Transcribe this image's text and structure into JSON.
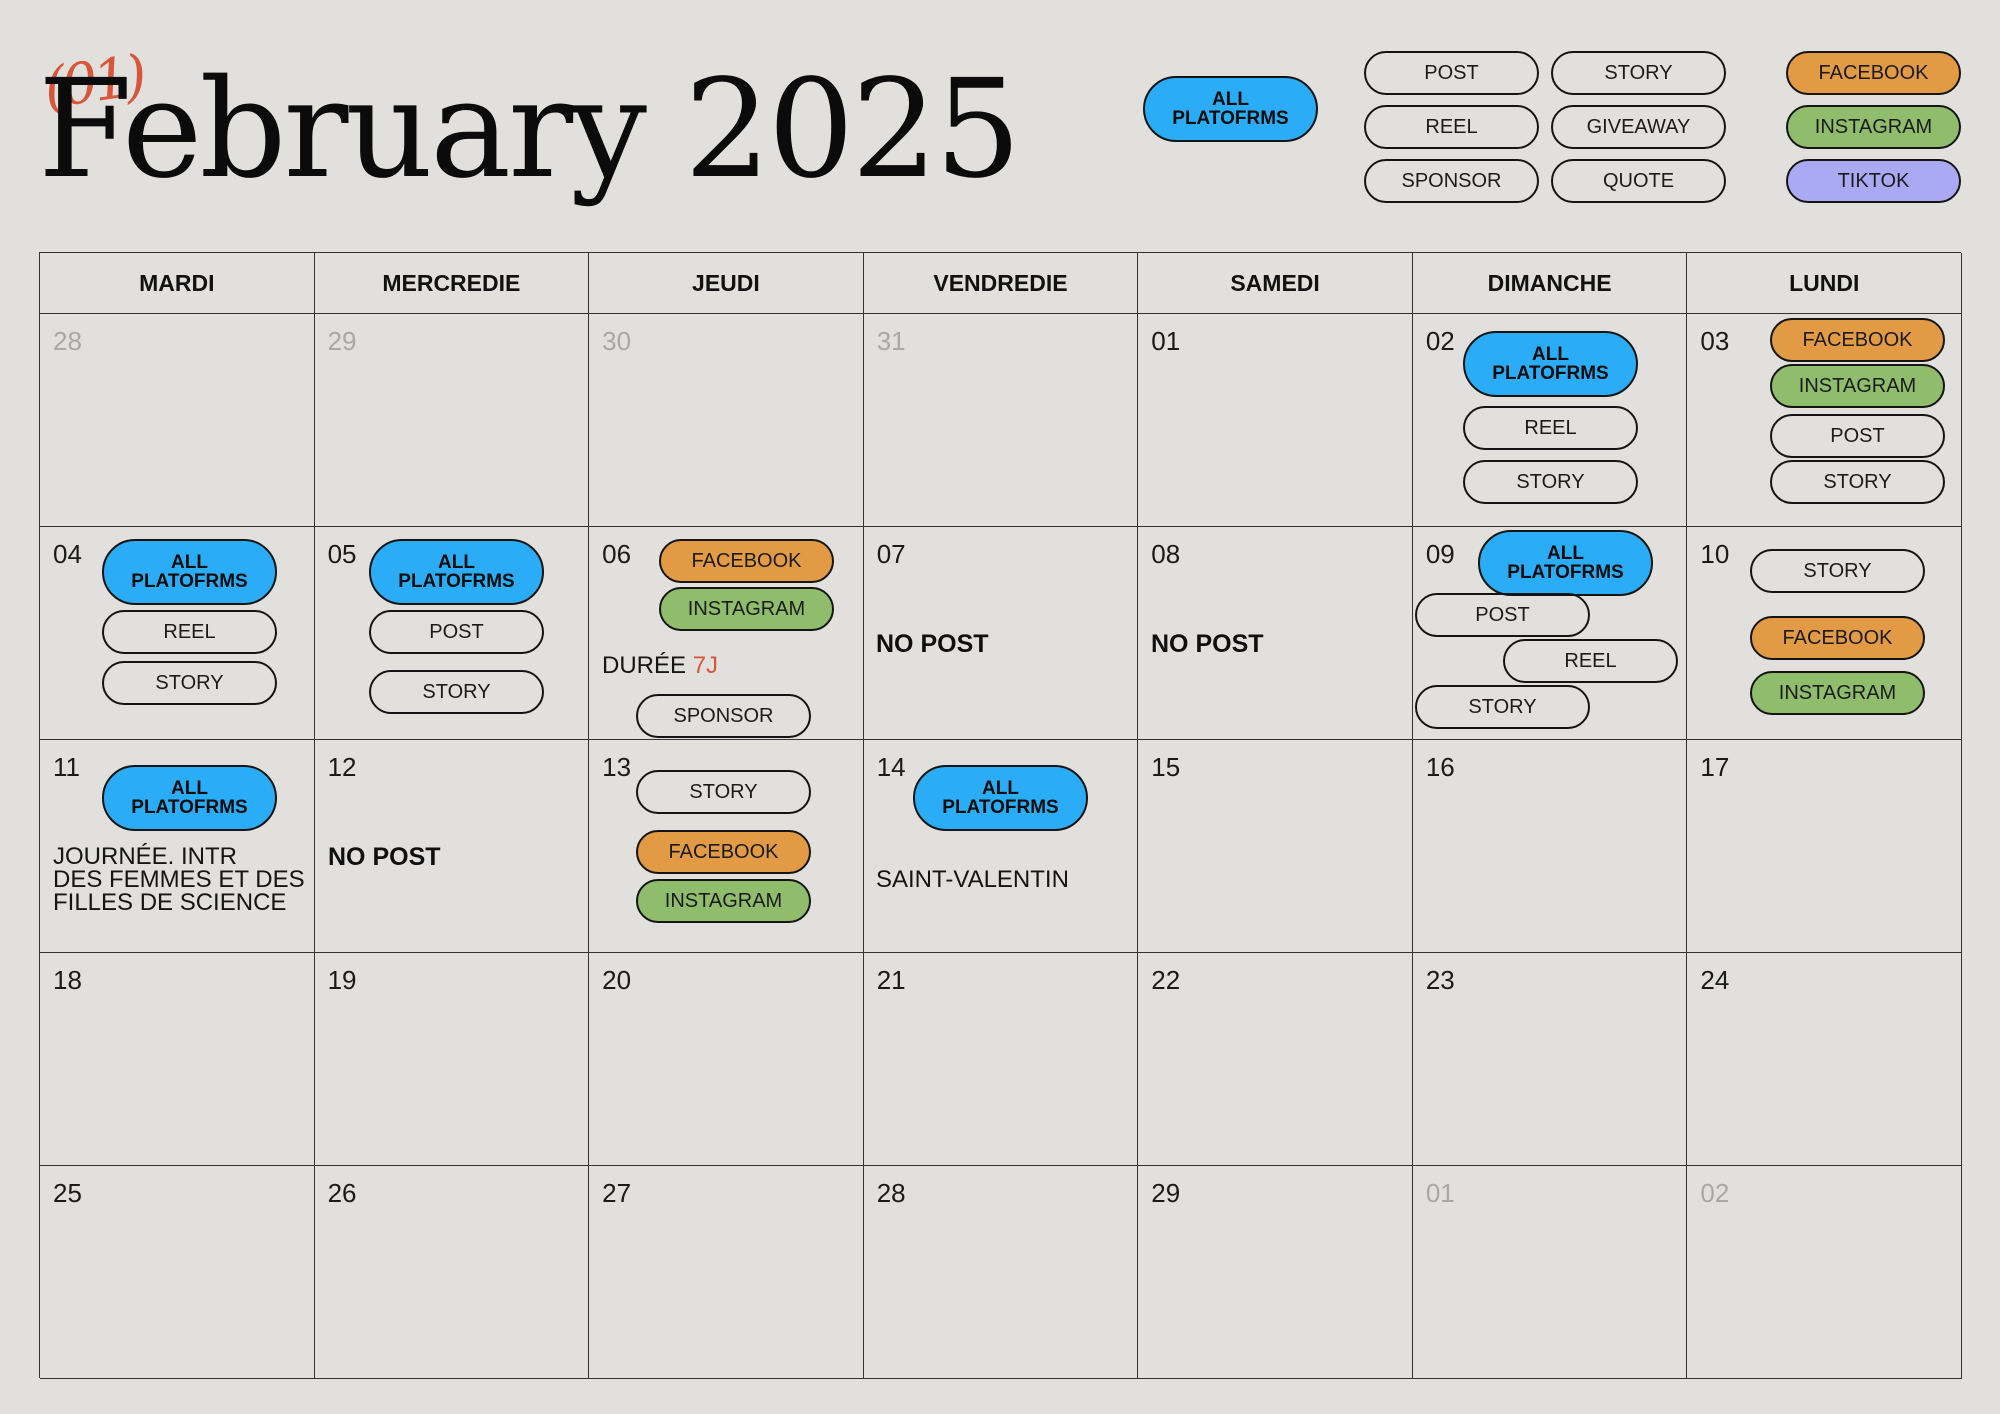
{
  "header": {
    "title_mark": "(01)",
    "title": "February 2025"
  },
  "legend": {
    "all_platforms": [
      "ALL",
      "PLATOFRMS"
    ],
    "types": [
      "POST",
      "STORY",
      "REEL",
      "GIVEAWAY",
      "SPONSOR",
      "QUOTE"
    ],
    "platforms": [
      "FACEBOOK",
      "INSTAGRAM",
      "TIKTOK"
    ]
  },
  "colors": {
    "all_platforms": "#2aacf6",
    "facebook": "#e29a45",
    "instagram": "#8fbd6c",
    "tiktok": "#aaaaf4",
    "accent": "#d8563a",
    "background": "#e1e0dc"
  },
  "weekdays": [
    "MARDI",
    "MERCREDIE",
    "JEUDI",
    "VENDREDIE",
    "SAMEDI",
    "DIMANCHE",
    "LUNDI"
  ],
  "weeks": [
    [
      "28",
      "29",
      "30",
      "31",
      "01",
      "02",
      "03"
    ],
    [
      "04",
      "05",
      "06",
      "07",
      "08",
      "09",
      "10"
    ],
    [
      "11",
      "12",
      "13",
      "14",
      "15",
      "16",
      "17"
    ],
    [
      "18",
      "19",
      "20",
      "21",
      "22",
      "23",
      "24"
    ],
    [
      "25",
      "26",
      "27",
      "28",
      "29",
      "01",
      "02"
    ]
  ],
  "labels": {
    "all": [
      "ALL",
      "PLATOFRMS"
    ],
    "post": "POST",
    "story": "STORY",
    "reel": "REEL",
    "sponsor": "SPONSOR",
    "facebook": "FACEBOOK",
    "instagram": "INSTAGRAM"
  },
  "notes": {
    "no_post": "NO POST",
    "duree_label": "DURÉE",
    "duree_value": "7J",
    "journee": [
      "JOURNÉE. INTR",
      "DES FEMMES ET DES",
      "FILLES DE SCIENCE"
    ],
    "valentin": "SAINT-VALENTIN"
  }
}
